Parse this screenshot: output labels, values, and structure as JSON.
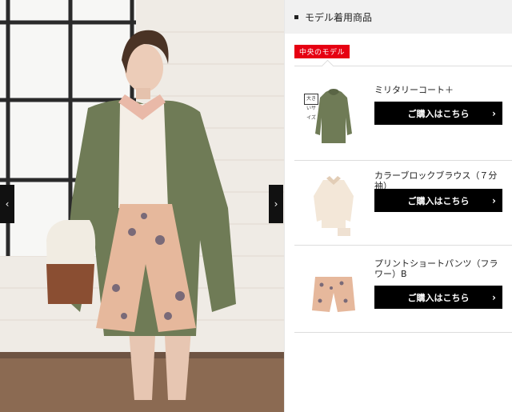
{
  "panel": {
    "title": "モデル着用商品",
    "tag": "中央のモデル"
  },
  "nav": {
    "prev": "‹",
    "next": "›"
  },
  "items": [
    {
      "name": "ミリタリーコート＋",
      "button": "ご購入はこちら",
      "badge": "大きいサイズ"
    },
    {
      "name": "カラーブロックブラウス（７分袖）",
      "button": "ご購入はこちら"
    },
    {
      "name": "プリントショートパンツ（フラワー）B",
      "button": "ご購入はこちら"
    }
  ],
  "colors": {
    "accent_red": "#e60012",
    "button_bg": "#000000",
    "coat": "#6f7b56",
    "shorts": "#e6b89c"
  }
}
